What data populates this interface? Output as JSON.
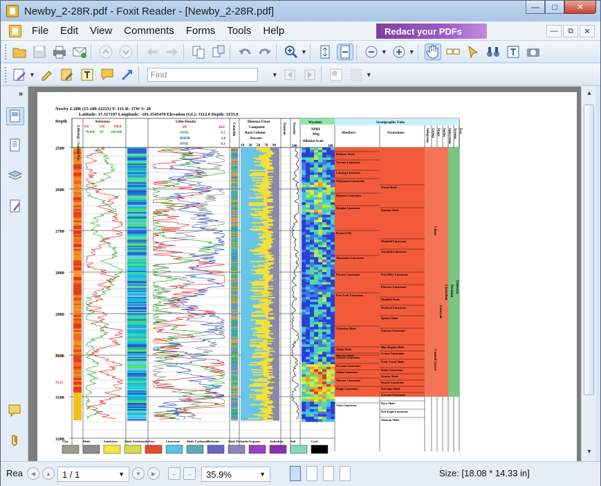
{
  "window": {
    "title": "Newby_2-28R.pdf - Foxit Reader - [Newby_2-28R.pdf]"
  },
  "menu": [
    "File",
    "Edit",
    "View",
    "Comments",
    "Forms",
    "Tools",
    "Help"
  ],
  "promo": {
    "label": "Redact your PDFs"
  },
  "find": {
    "placeholder": "Find"
  },
  "status": {
    "page": "1 / 1",
    "zoom": "35.9%",
    "size": "Size: [18.08 * 14.33 in]",
    "left_label": "Rea"
  },
  "log": {
    "header_line1": "Newby 2-28R (15-189-22225) T: 31S R: 37W S: 20",
    "header_line2": "Latitude: 37.317197 Longitude: -101.3545478 Elevation (GL): 3112.0 Depth: 3155.0",
    "depth_label": "Depth",
    "depth_ticks": [
      "2500",
      "2600",
      "2700",
      "2800",
      "2900",
      "3000",
      "3100",
      "3200"
    ],
    "track_titles": {
      "gamma": "Lithology / Gamma Ray",
      "reference": "Reference",
      "gr": "GR",
      "gr_range": "150.0",
      "sp": "SP",
      "sp_range": "160.948",
      "ref_left": "0.0",
      "ref_left2": "-70.030",
      "litho_density": "Litho-Density",
      "pe": "PE",
      "pe_range": "20.0",
      "nphi": "NPHI",
      "nphi_range": "-0.1",
      "rhob": "RHOB",
      "rhob_range": "3.0",
      "dphi": "DPHI",
      "dphi_range": "-0.1",
      "colorlith": "Colorlith",
      "rhomaa": "Rhomaa-Umaa",
      "computed": "Computed",
      "rock_column": "Rock Column",
      "percent": "Percent",
      "percent_ticks": [
        "10",
        "30",
        "50",
        "70",
        "90"
      ],
      "neutron": "Neutron",
      "porosity": "Porosity",
      "wavelet": "Wavelets",
      "wavelet_nphi": "NPHI",
      "wavelet_mag": "Mag",
      "wavelet_scale": "Dilation Scale",
      "wavelet_ticks": [
        "500",
        "100"
      ],
      "strat": "Stratigraphic Units",
      "members": "Members",
      "formations": "Formations",
      "subgroup": "Subgroup",
      "group": "Group",
      "stage": "Stage",
      "series": "Series",
      "subsystem": "Subsystem",
      "system": "System",
      "era": "Era"
    },
    "members": [
      {
        "name": "Heebner Shale",
        "depth": 2510
      },
      {
        "name": "Toronto Limestone",
        "depth": 2530
      },
      {
        "name": "Lansing Limestone",
        "depth": 2555
      },
      {
        "name": "Wabaunsee Limestone",
        "depth": 2575
      },
      {
        "name": "Shawnee Limestone",
        "depth": 2610
      },
      {
        "name": "Douglas Limestone",
        "depth": 2640
      },
      {
        "name": "Kansas City",
        "depth": 2700
      },
      {
        "name": "Marmaton Limestone",
        "depth": 2760
      },
      {
        "name": "Pawnee Limestone",
        "depth": 2800
      },
      {
        "name": "Fort Scott Limestone",
        "depth": 2850
      },
      {
        "name": "Cherokee Shale",
        "depth": 2930
      },
      {
        "name": "Atoka Shale",
        "depth": 2980
      },
      {
        "name": "Morrow Shale",
        "depth": 2995
      },
      {
        "name": "Chester Limestone",
        "depth": 3000
      },
      {
        "name": "St Louis Limestone",
        "depth": 3020
      },
      {
        "name": "Salem Limestone",
        "depth": 3035
      },
      {
        "name": "Warsaw Limestone",
        "depth": 3055
      },
      {
        "name": "Osage Limestone",
        "depth": 3075
      },
      {
        "name": "Viola Limestone",
        "depth": 3115
      }
    ],
    "formations": [
      {
        "name": "Oread Shale",
        "depth": 2590
      },
      {
        "name": "Stanton Shale",
        "depth": 2645
      },
      {
        "name": "Winfield Limestone",
        "depth": 2720
      },
      {
        "name": "Towanda Limestone",
        "depth": 2745
      },
      {
        "name": "Fort Riley Limestone",
        "depth": 2800
      },
      {
        "name": "Florence Limestone",
        "depth": 2830
      },
      {
        "name": "Matfield Shale",
        "depth": 2860
      },
      {
        "name": "Wreford Limestone",
        "depth": 2880
      },
      {
        "name": "Speiser Shale",
        "depth": 2905
      },
      {
        "name": "Funston Limestone",
        "depth": 2935
      },
      {
        "name": "Blue Rapids Shale",
        "depth": 2975
      },
      {
        "name": "Crouse Limestone",
        "depth": 2990
      },
      {
        "name": "Easly Creek Shale",
        "depth": 3010
      },
      {
        "name": "Bader Limestone",
        "depth": 3030
      },
      {
        "name": "Stearns Shale",
        "depth": 3045
      },
      {
        "name": "Beattie Limestone",
        "depth": 3060
      },
      {
        "name": "Eskridge Shale",
        "depth": 3075
      },
      {
        "name": "Grenola Limestone",
        "depth": 3090
      },
      {
        "name": "Roca Shale",
        "depth": 3110
      },
      {
        "name": "Red Eagle Limestone",
        "depth": 3130
      },
      {
        "name": "Johnson Shale",
        "depth": 3150
      }
    ],
    "groups": [
      {
        "name": "Chase",
        "depth": 2690
      },
      {
        "name": "Council Grove",
        "depth": 2985
      }
    ],
    "stage": "Gearyan",
    "series": "Cisuralian",
    "subsystem": "Permian",
    "system": "Paleozoic",
    "perf_labels": [
      "Perf",
      "Perf"
    ],
    "legend": [
      {
        "name": "Clay",
        "color": "#9c9c8a"
      },
      {
        "name": "Shale",
        "color": "#8d8d8d"
      },
      {
        "name": "Sandstone",
        "color": "#f5e63a"
      },
      {
        "name": "Shaly Sandstone",
        "color": "#d8d94a"
      },
      {
        "name": "Arkose",
        "color": "#e84b2c"
      },
      {
        "name": "Limestone",
        "color": "#56c3e8"
      },
      {
        "name": "Shaly Carbonate",
        "color": "#5fa9b9"
      },
      {
        "name": "Dolomite",
        "color": "#6b66c8"
      },
      {
        "name": "Shaly Dolomite",
        "color": "#8d84b5"
      },
      {
        "name": "Gypsum",
        "color": "#9d3fc4"
      },
      {
        "name": "Anhydrite",
        "color": "#8a2fb5"
      },
      {
        "name": "Salt",
        "color": "#86d7bb"
      },
      {
        "name": "Coal",
        "color": "#000000"
      }
    ]
  }
}
